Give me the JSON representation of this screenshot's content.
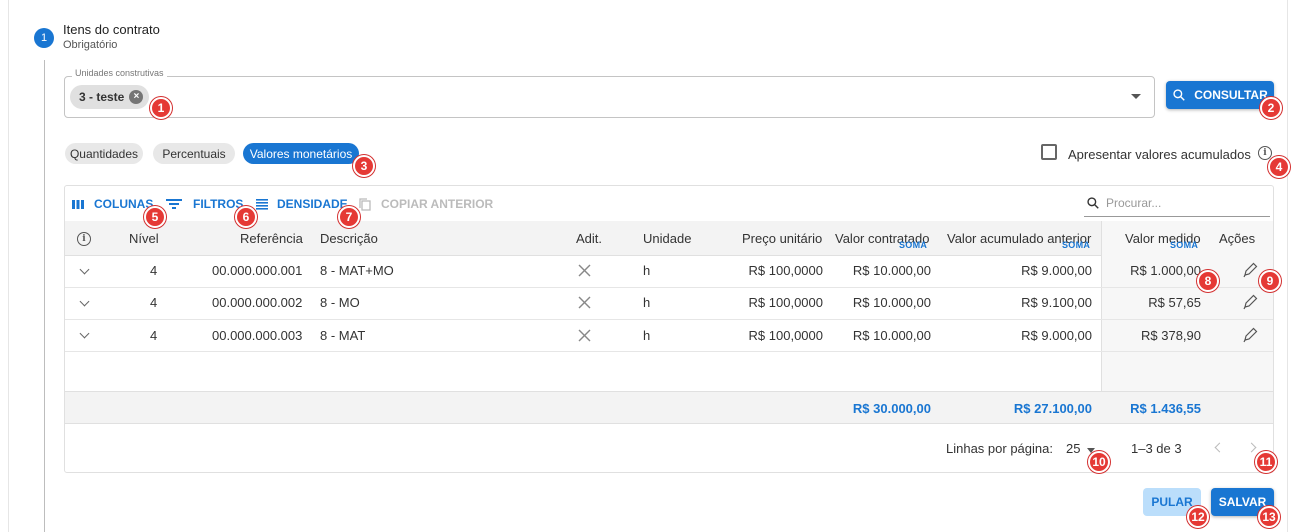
{
  "step": {
    "number": "1",
    "title": "Itens do contrato",
    "subtitle": "Obrigatório"
  },
  "units_field": {
    "label": "Unidades construtivas",
    "chip": "3 - teste",
    "chip_remove": "×"
  },
  "consult_button": "CONSULTAR",
  "view_toggles": [
    "Quantidades",
    "Percentuais",
    "Valores monetários"
  ],
  "active_toggle": "Valores monetários",
  "accumulated_checkbox": {
    "label": "Apresentar valores acumulados",
    "checked": false
  },
  "toolbar": {
    "columns": "COLUNAS",
    "filters": "FILTROS",
    "density": "DENSIDADE",
    "copy_previous": "COPIAR ANTERIOR"
  },
  "search": {
    "placeholder": "Procurar..."
  },
  "columns": {
    "nivel": "Nível",
    "referencia": "Referência",
    "descricao": "Descrição",
    "adit": "Adit.",
    "unidade": "Unidade",
    "preco": "Preço unitário",
    "contratado": "Valor contratado",
    "acumulado": "Valor acumulado anterior",
    "medido": "Valor medido",
    "acoes": "Ações",
    "soma": "SOMA"
  },
  "rows": [
    {
      "nivel": "4",
      "referencia": "00.000.000.001",
      "descricao": "8 - MAT+MO",
      "unidade": "h",
      "preco": "R$ 100,0000",
      "contratado": "R$ 10.000,00",
      "acumulado": "R$ 9.000,00",
      "medido": "R$ 1.000,00"
    },
    {
      "nivel": "4",
      "referencia": "00.000.000.002",
      "descricao": "8 - MO",
      "unidade": "h",
      "preco": "R$ 100,0000",
      "contratado": "R$ 10.000,00",
      "acumulado": "R$ 9.100,00",
      "medido": "R$ 57,65"
    },
    {
      "nivel": "4",
      "referencia": "00.000.000.003",
      "descricao": "8 - MAT",
      "unidade": "h",
      "preco": "R$ 100,0000",
      "contratado": "R$ 10.000,00",
      "acumulado": "R$ 9.000,00",
      "medido": "R$ 378,90"
    }
  ],
  "totals": {
    "contratado": "R$ 30.000,00",
    "acumulado": "R$ 27.100,00",
    "medido": "R$ 1.436,55"
  },
  "pagination": {
    "label": "Linhas por página:",
    "page_size": "25",
    "range": "1–3 de 3"
  },
  "actions": {
    "skip": "PULAR",
    "save": "SALVAR"
  },
  "badges": [
    "1",
    "2",
    "3",
    "4",
    "5",
    "6",
    "7",
    "8",
    "9",
    "10",
    "11",
    "12",
    "13"
  ],
  "colors": {
    "primary": "#1976d2",
    "badge": "#e53935",
    "skip_bg": "#bbdefb"
  }
}
